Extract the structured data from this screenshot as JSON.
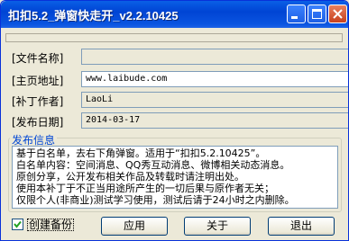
{
  "window": {
    "title": "扣扣5.2_弹窗快走开_v2.2.10425"
  },
  "fields": [
    {
      "label": "[文件名称]",
      "value": ""
    },
    {
      "label": "[主页地址]",
      "value": "www.laibude.com"
    },
    {
      "label": "[补丁作者]",
      "value": "LaoLi"
    },
    {
      "label": "[发布日期]",
      "value": "2014-03-17"
    }
  ],
  "release_info": {
    "caption": "发布信息",
    "lines": [
      "基于白名单，去右下角弹窗。适用于“扣扣5.2.10425”。",
      "白名单内容：空间消息、QQ秀互动消息、微博相关动态消息。",
      "原创分享，公开发布相关作品及转载时请注明出处。",
      "使用本补丁于不正当用途所产生的一切后果与原作者无关；",
      "仅限个人(非商业)测试学习使用，测试后请于24小时之内删除。"
    ]
  },
  "footer": {
    "checkbox_label": "创建备份",
    "checkbox_checked": true,
    "apply_label": "应用",
    "about_label": "关于",
    "exit_label": "退出"
  }
}
